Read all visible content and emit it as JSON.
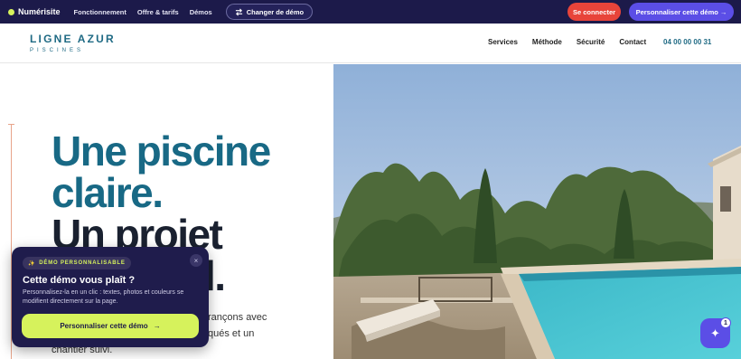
{
  "demobar": {
    "brand": "Numérisite",
    "nav": [
      "Fonctionnement",
      "Offre & tarifs",
      "Démos"
    ],
    "switch_label": "Changer de démo",
    "login_label": "Se connecter",
    "custom_label": "Personnaliser cette démo →"
  },
  "site": {
    "logo_main": "LIGNE AZUR",
    "logo_sub": "PISCINES",
    "nav": [
      "Services",
      "Méthode",
      "Sécurité",
      "Contact"
    ],
    "phone": "04 00 00 00 31"
  },
  "hero": {
    "line1": "Une piscine",
    "line2": "claire.",
    "line3": "Un projet",
    "line4": "l.",
    "text_line1": "rançons avec",
    "text_line2": "qués et un",
    "text_line3": "chantier suivi."
  },
  "popup": {
    "badge": "DÉMO PERSONNALISABLE",
    "close": "×",
    "title": "Cette démo vous plaît ?",
    "desc": "Personnalisez-la en un clic : textes, photos et couleurs se modifient directement sur la page.",
    "cta": "Personnaliser cette démo",
    "cta_arrow": "→"
  },
  "fab": {
    "badge_count": "1"
  },
  "colors": {
    "navy": "#1c1a4a",
    "accent": "#5b4ee6",
    "lime": "#d6f25c",
    "red": "#e8443a",
    "teal": "#186985"
  }
}
